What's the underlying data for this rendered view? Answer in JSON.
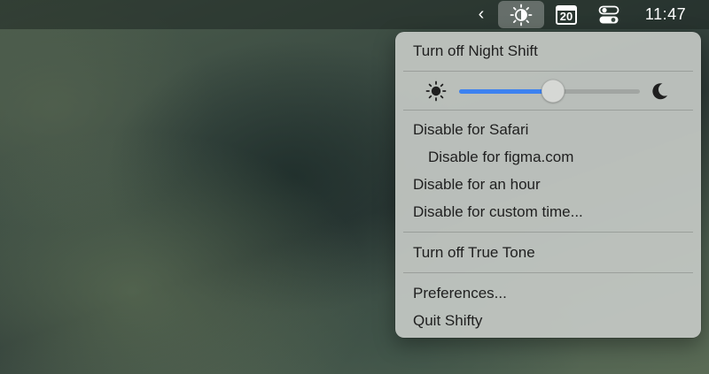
{
  "menubar": {
    "chevron": "‹",
    "calendar_day": "20",
    "clock": "11:47"
  },
  "menu": {
    "toggle_night_shift": "Turn off Night Shift",
    "slider": {
      "value": 0.52,
      "fill_color": "#3d82f0",
      "left_icon": "sun-icon",
      "right_icon": "moon-icon"
    },
    "disable_app": "Disable for Safari",
    "disable_domain": "Disable for figma.com",
    "disable_hour": "Disable for an hour",
    "disable_custom": "Disable for custom time...",
    "toggle_true_tone": "Turn off True Tone",
    "preferences": "Preferences...",
    "quit": "Quit Shifty"
  },
  "icons": {
    "shifty": "shifty-sun-icon",
    "calendar": "calendar-icon",
    "control_center": "control-center-icon"
  }
}
